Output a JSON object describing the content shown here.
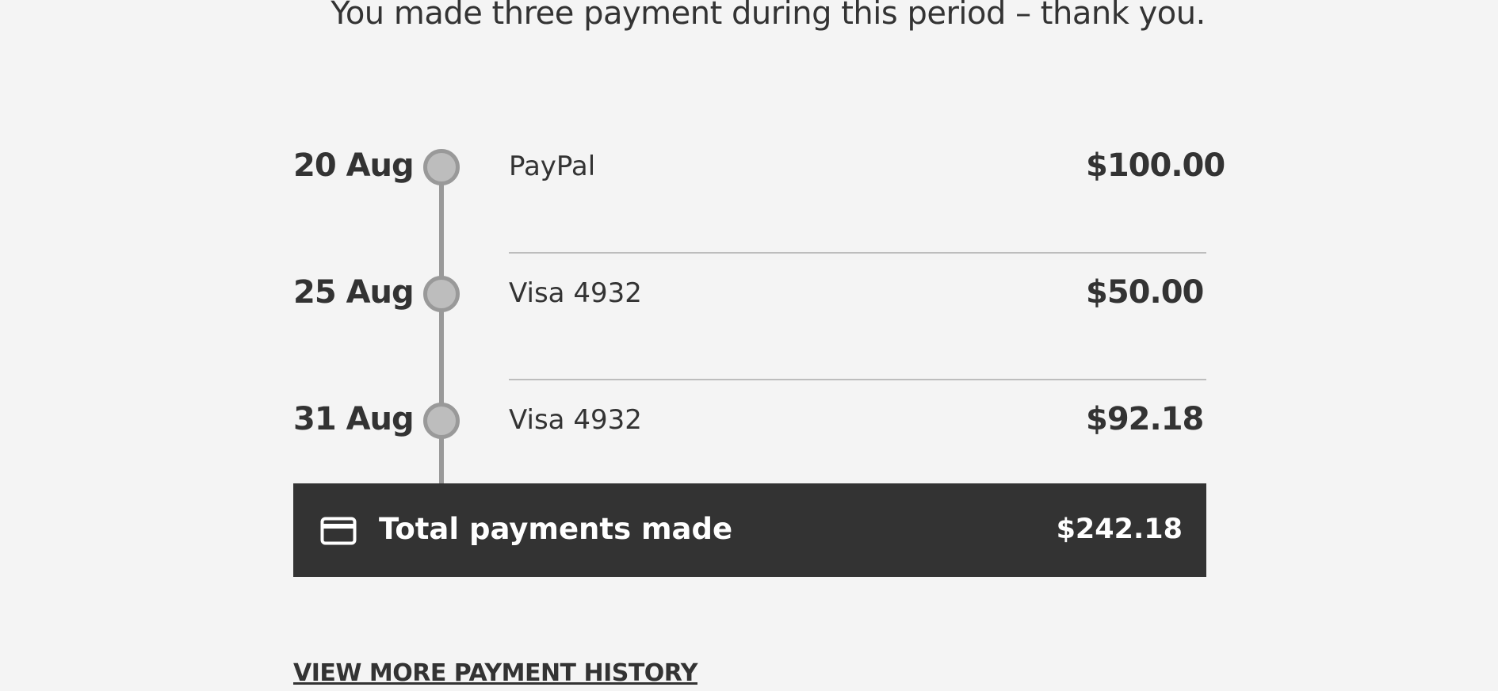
{
  "summary": {
    "message": "You made three payment during this period – thank you."
  },
  "payments": [
    {
      "date": "20 Aug",
      "method": "PayPal",
      "amount": "$100.00"
    },
    {
      "date": "25 Aug",
      "method": "Visa 4932",
      "amount": "$50.00"
    },
    {
      "date": "31 Aug",
      "method": "Visa 4932",
      "amount": "$92.18"
    }
  ],
  "total": {
    "icon": "credit-card-icon",
    "label": "Total payments made",
    "amount": "$242.18"
  },
  "history_link": {
    "label": "VIEW MORE PAYMENT HISTORY"
  },
  "colors": {
    "background": "#f4f4f4",
    "text": "#333333",
    "timeline": "#999999",
    "node_fill": "#bdbdbd",
    "total_bar": "#333333"
  }
}
